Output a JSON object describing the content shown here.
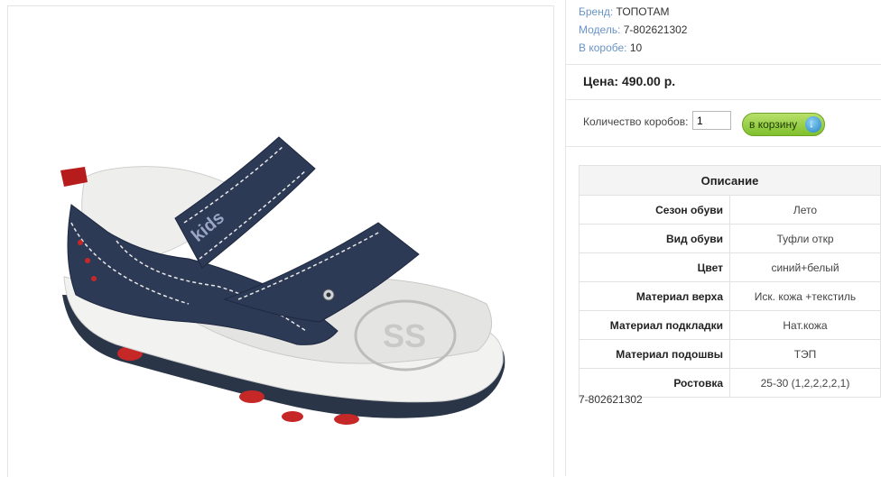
{
  "product": {
    "brand_label": "Бренд:",
    "brand_value": "ТОПОТАМ",
    "model_label": "Модель:",
    "model_value": "7-802621302",
    "box_label": "В коробе:",
    "box_value": "10",
    "price_text": "Цена: 490.00 р.",
    "qty_label": "Количество коробов:",
    "qty_value": "1",
    "cart_label": "в корзину",
    "sku_text": "7-802621302"
  },
  "description": {
    "title": "Описание",
    "rows": [
      {
        "label": "Сезон обуви",
        "value": "Лето"
      },
      {
        "label": "Вид обуви",
        "value": "Туфли откр"
      },
      {
        "label": "Цвет",
        "value": "синий+белый"
      },
      {
        "label": "Материал верха",
        "value": "Иск. кожа +текстиль"
      },
      {
        "label": "Материал подкладки",
        "value": "Нат.кожа"
      },
      {
        "label": "Материал подошвы",
        "value": "ТЭП"
      },
      {
        "label": "Ростовка",
        "value": "25-30 (1,2,2,2,2,1)"
      }
    ]
  },
  "image": {
    "strap_text": "kids",
    "icon": "sandal-product-photo"
  }
}
